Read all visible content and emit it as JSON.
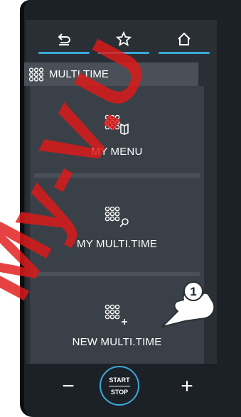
{
  "nav": {
    "back_icon": "return-arrow-icon",
    "favorites_icon": "star-icon",
    "home_icon": "home-icon",
    "accent_color": "#3aa9d8"
  },
  "header": {
    "icon": "multi-time-grid-icon",
    "title": "MULTI.TIME"
  },
  "menu": {
    "items": [
      {
        "label": "MY MENU",
        "icon": "multi-time-book-icon"
      },
      {
        "label": "MY MULTI.TIME",
        "icon": "multi-time-search-icon"
      },
      {
        "label": "NEW MULTI.TIME",
        "icon": "multi-time-add-icon"
      }
    ]
  },
  "controls": {
    "minus": "−",
    "plus": "+",
    "start": "START",
    "stop": "STOP"
  },
  "callout": {
    "number": "1",
    "icon": "pointing-hand-icon"
  },
  "watermark": {
    "text": "My-V.U",
    "color": "#e01818"
  }
}
